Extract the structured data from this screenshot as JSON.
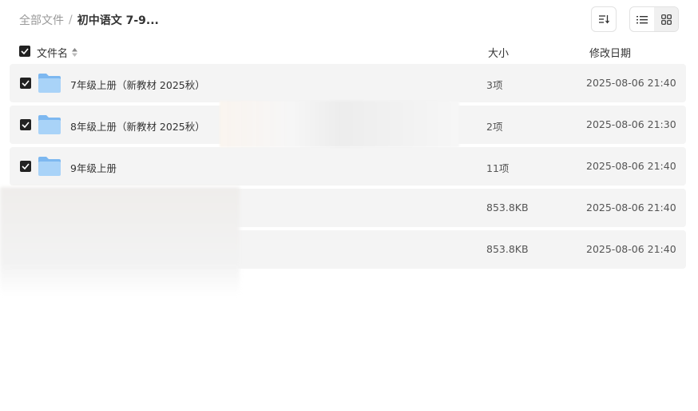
{
  "breadcrumb": {
    "root": "全部文件",
    "separator": "/",
    "current": "初中语文 7-9..."
  },
  "header": {
    "name": "文件名",
    "size": "大小",
    "date": "修改日期"
  },
  "toolbar": {
    "sort_icon": "sort-icon",
    "list_icon": "list-view-icon",
    "grid_icon": "grid-view-icon"
  },
  "rows": [
    {
      "name": "7年级上册（新教材 2025秋）",
      "size": "3项",
      "date": "2025-08-06 21:40",
      "type": "folder",
      "checked": true
    },
    {
      "name": "8年级上册（新教材 2025秋）",
      "size": "2项",
      "date": "2025-08-06 21:30",
      "type": "folder",
      "checked": true
    },
    {
      "name": "9年级上册",
      "size": "11项",
      "date": "2025-08-06 21:40",
      "type": "folder",
      "checked": true
    },
    {
      "name": "",
      "size": "853.8KB",
      "date": "2025-08-06 21:40",
      "type": "file",
      "checked": false
    },
    {
      "name": "",
      "size": "853.8KB",
      "date": "2025-08-06 21:40",
      "type": "file",
      "checked": false
    }
  ]
}
